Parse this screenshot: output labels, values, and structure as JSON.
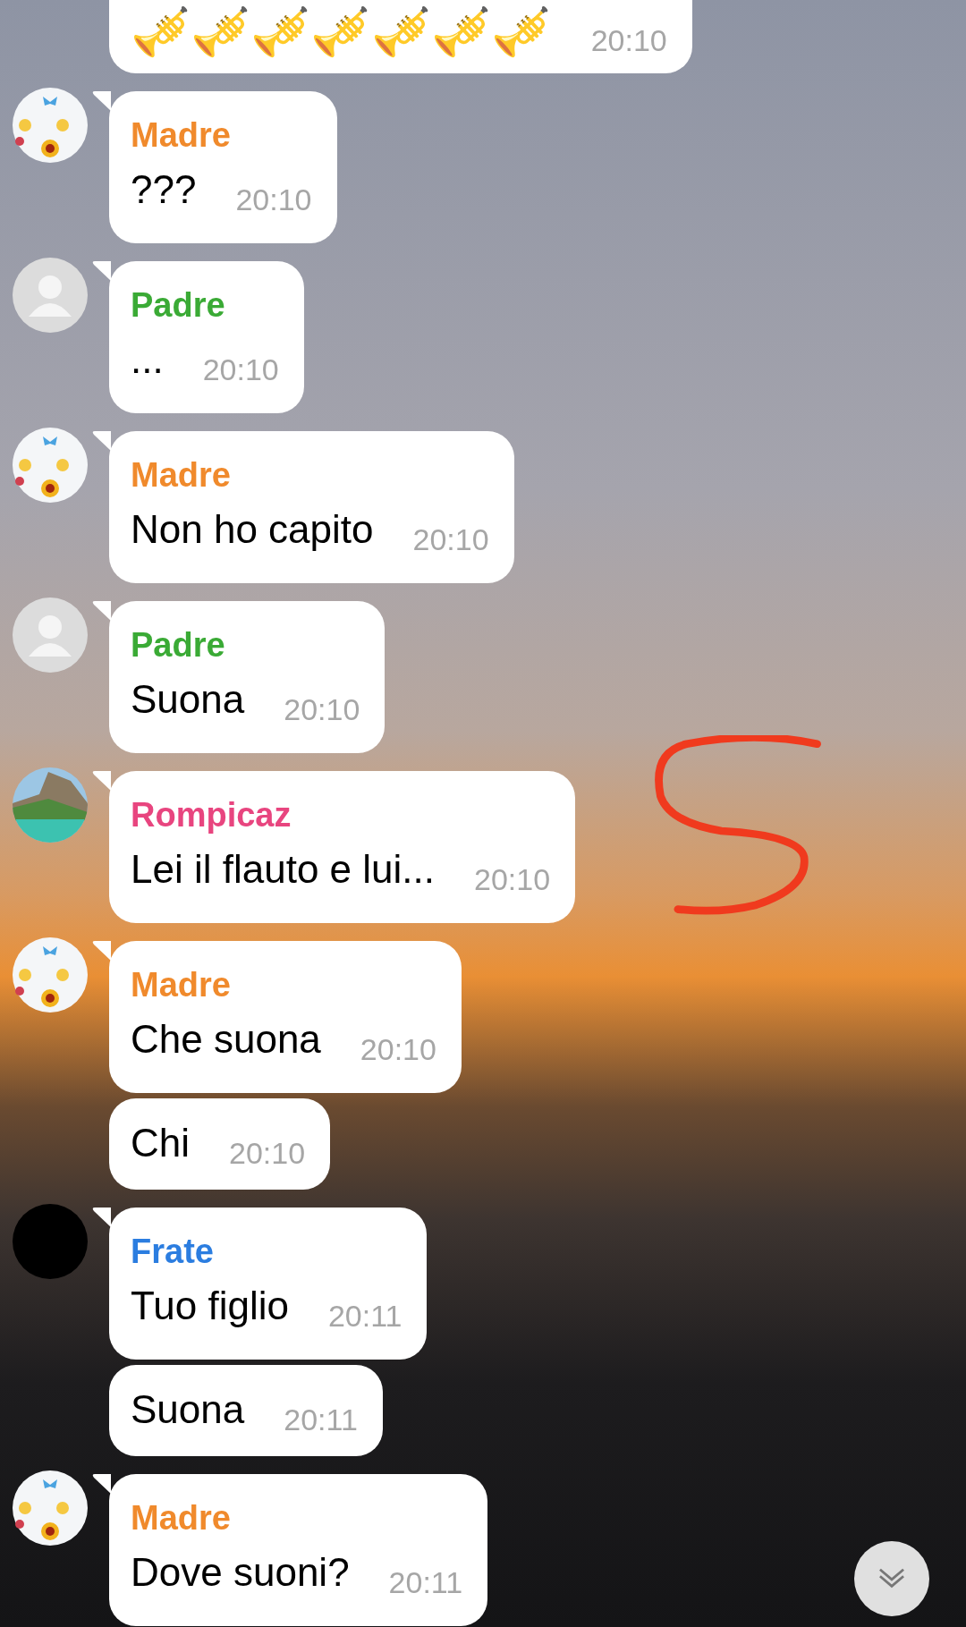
{
  "groups": [
    {
      "messages": [
        {
          "kind": "emoji",
          "text": "🎺🎺🎺🎺🎺🎺🎺",
          "time": "20:10"
        }
      ]
    },
    {
      "sender": "Madre",
      "color": "#f08a2c",
      "avatar": {
        "kind": "picture"
      },
      "messages": [
        {
          "kind": "text",
          "text": "???",
          "time": "20:10"
        }
      ]
    },
    {
      "sender": "Padre",
      "color": "#3aaa35",
      "avatar": {
        "kind": "silhouette"
      },
      "messages": [
        {
          "kind": "text",
          "text": "...",
          "time": "20:10"
        }
      ]
    },
    {
      "sender": "Madre",
      "color": "#f08a2c",
      "avatar": {
        "kind": "picture"
      },
      "messages": [
        {
          "kind": "text",
          "text": "Non ho capito",
          "time": "20:10"
        }
      ]
    },
    {
      "sender": "Padre",
      "color": "#3aaa35",
      "avatar": {
        "kind": "silhouette"
      },
      "messages": [
        {
          "kind": "text",
          "text": "Suona",
          "time": "20:10"
        }
      ]
    },
    {
      "sender": "Rompicaz",
      "color": "#e8457f",
      "avatar": {
        "kind": "photo"
      },
      "messages": [
        {
          "kind": "text",
          "text": "Lei il flauto e lui...",
          "time": "20:10"
        }
      ]
    },
    {
      "sender": "Madre",
      "color": "#f08a2c",
      "avatar": {
        "kind": "picture"
      },
      "messages": [
        {
          "kind": "text",
          "text": "Che suona",
          "time": "20:10"
        },
        {
          "kind": "text",
          "text": "Chi",
          "time": "20:10"
        }
      ]
    },
    {
      "sender": "Frate",
      "color": "#2b7de0",
      "avatar": {
        "kind": "dark"
      },
      "messages": [
        {
          "kind": "text",
          "text": "Tuo figlio",
          "time": "20:11"
        },
        {
          "kind": "text",
          "text": "Suona",
          "time": "20:11"
        }
      ]
    },
    {
      "sender": "Madre",
      "color": "#f08a2c",
      "avatar": {
        "kind": "picture"
      },
      "messages": [
        {
          "kind": "text",
          "text": "Dove suoni?",
          "time": "20:11"
        }
      ]
    }
  ]
}
